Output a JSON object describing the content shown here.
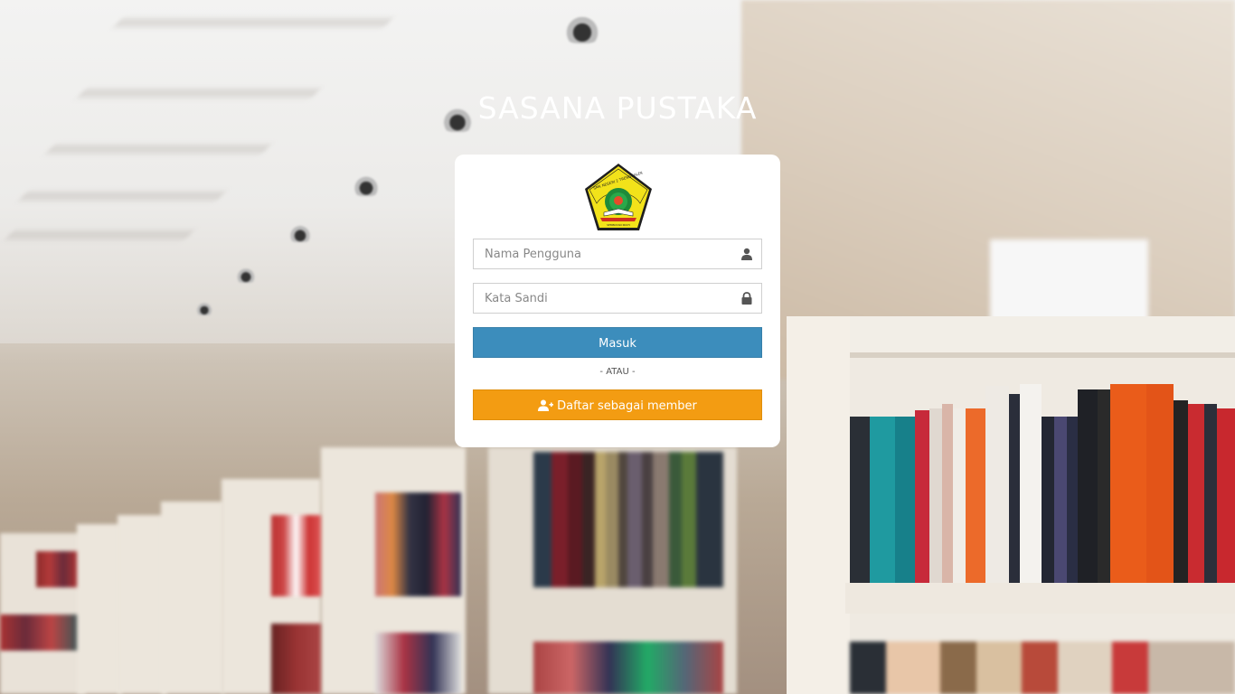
{
  "app": {
    "title": "SASANA PUSTAKA"
  },
  "login": {
    "username_placeholder": "Nama Pengguna",
    "username_value": "",
    "password_placeholder": "Kata Sandi",
    "password_value": "",
    "login_label": "Masuk",
    "separator": "- ATAU -",
    "register_label": "Daftar sebagai member"
  },
  "logo": {
    "text_top": "SMK NEGERI 2 TRENGGALEK",
    "text_bottom": "SEMBOYAN PASTI"
  },
  "icons": {
    "username": "user-icon",
    "password": "lock-icon",
    "register": "user-plus-icon"
  },
  "colors": {
    "login_button": "#3c8dbc",
    "register_button": "#f39c12",
    "card": "#ffffff",
    "title": "#ffffff"
  }
}
